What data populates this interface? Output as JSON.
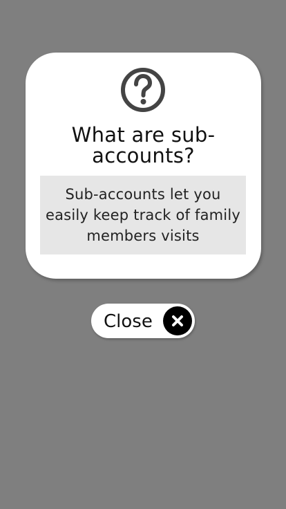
{
  "dialog": {
    "icon": "question-circle-icon",
    "title": "What are sub-accounts?",
    "message": "Sub-accounts let you easily keep track of family members visits"
  },
  "close_button": {
    "label": "Close",
    "icon": "close-icon"
  }
}
